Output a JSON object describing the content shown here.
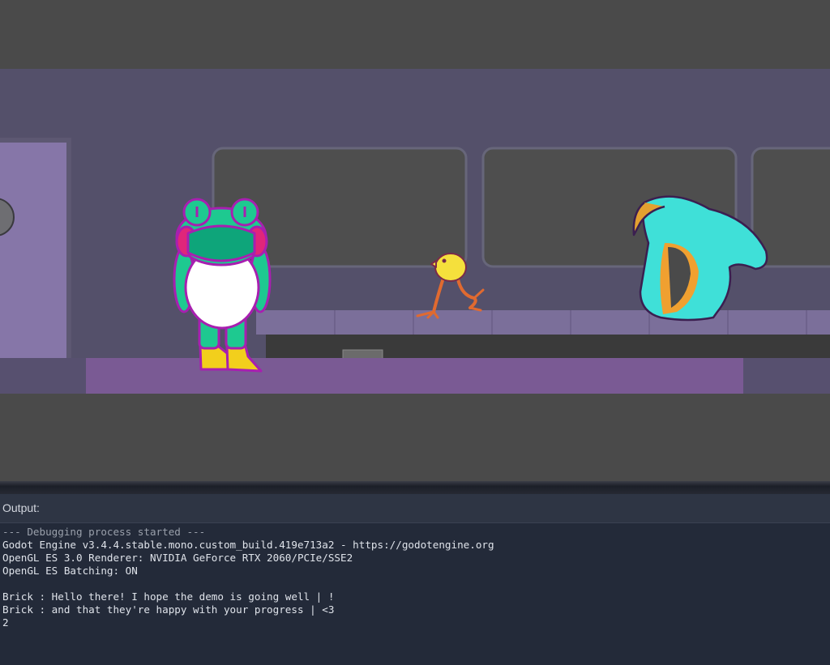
{
  "output_panel": {
    "title": "Output:",
    "lines": [
      "--- Debugging process started ---",
      "Godot Engine v3.4.4.stable.mono.custom_build.419e713a2 - https://godotengine.org",
      "OpenGL ES 3.0 Renderer: NVIDIA GeForce RTX 2060/PCIe/SSE2",
      "OpenGL ES Batching: ON",
      "",
      "Brick : Hello there! I hope the demo is going well | !",
      "Brick : and that they're happy with your progress | <3",
      "2"
    ]
  },
  "scene": {
    "characters": [
      "frog-character",
      "duck-character",
      "shark-character"
    ],
    "colors": {
      "wall": "#54506a",
      "window": "#4e4e4e",
      "floor": "#7a5a94",
      "counter": "#7b6f9a",
      "door": "#8676a8",
      "frog_green": "#1ec990",
      "frog_outline": "#a81fb0",
      "duck_yellow": "#f5e03c",
      "shark_cyan": "#3fe0d8"
    }
  }
}
